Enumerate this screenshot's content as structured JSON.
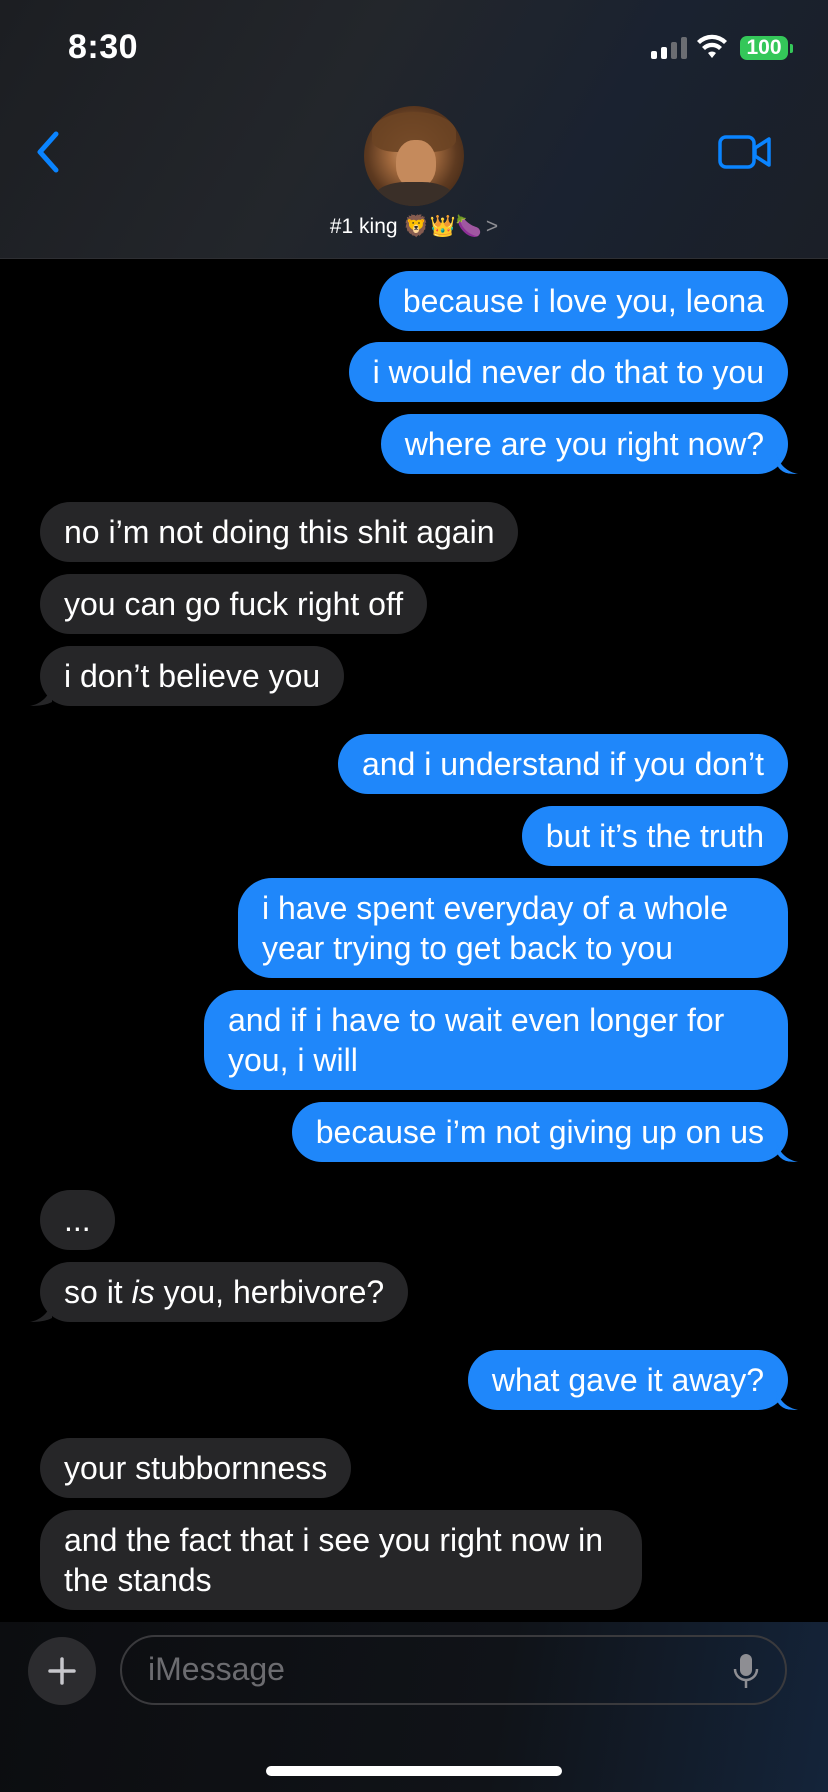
{
  "status_bar": {
    "time": "8:30",
    "battery": "100"
  },
  "header": {
    "contact_name": "#1 king 🦁👑🍆",
    "chevron": ">"
  },
  "messages": [
    {
      "text": "because i love you, leona"
    },
    {
      "text": "i would never do that to you"
    },
    {
      "text": "where are you right now?"
    },
    {
      "text": "no i’m not doing this shit again"
    },
    {
      "text": "you can go fuck right off"
    },
    {
      "text": "i don’t believe you"
    },
    {
      "text": "and i understand if you don’t"
    },
    {
      "text": "but it’s the truth"
    },
    {
      "text": "i have spent everyday of a whole year trying to get back to you"
    },
    {
      "text": "and if i have to wait even longer for you, i will"
    },
    {
      "text": "because i’m not giving up on us"
    },
    {
      "text": "..."
    },
    {
      "pre": "so it ",
      "em": "is",
      "post": " you, herbivore?"
    },
    {
      "text": "what gave it away?"
    },
    {
      "text": "your stubbornness"
    },
    {
      "text": "and the fact that i see you right now in the stands"
    }
  ],
  "composer": {
    "placeholder": "iMessage"
  },
  "colors": {
    "sent": "#1f87fa",
    "received": "#262628",
    "accent": "#0a84ff"
  }
}
